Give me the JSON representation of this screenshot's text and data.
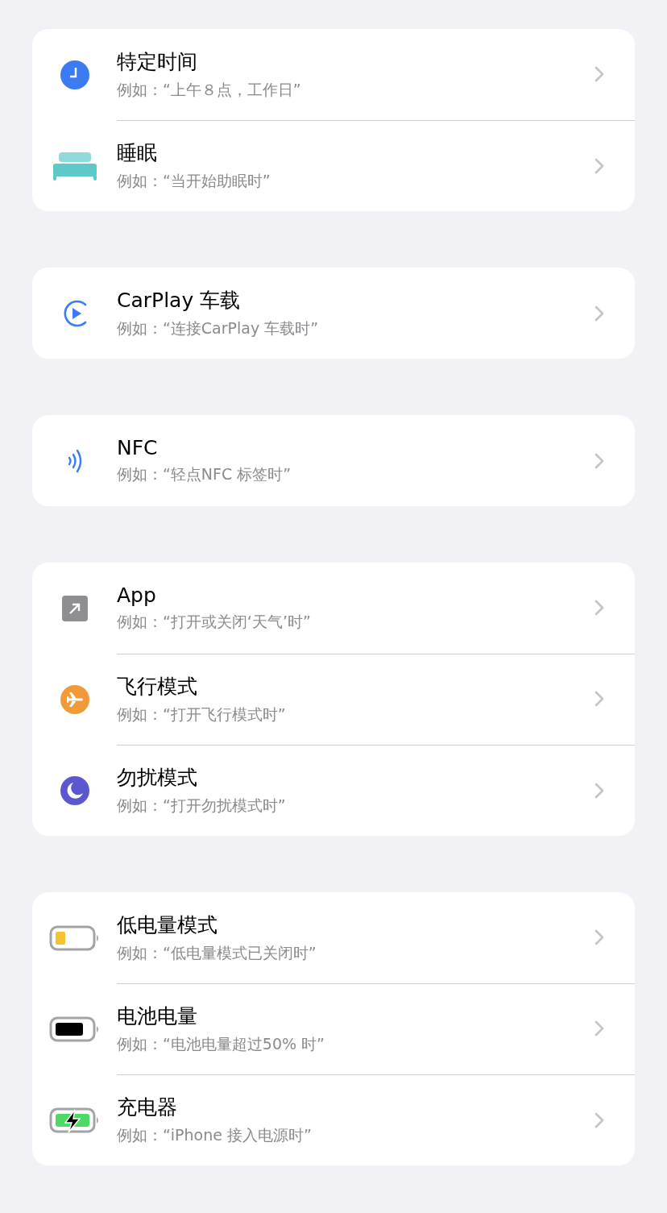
{
  "groups": [
    {
      "items": [
        {
          "kind": "time",
          "title": "特定时间",
          "subtitle": "例如：“上午８点，工作日”"
        },
        {
          "kind": "sleep",
          "title": "睡眠",
          "subtitle": "例如：“当开始助眠时”"
        }
      ]
    },
    {
      "items": [
        {
          "kind": "carplay",
          "title": "CarPlay 车载",
          "subtitle": "例如：“连接CarPlay 车载时”"
        }
      ]
    },
    {
      "items": [
        {
          "kind": "nfc",
          "title": "NFC",
          "subtitle": "例如：“轻点NFC 标签时”"
        }
      ]
    },
    {
      "items": [
        {
          "kind": "app",
          "title": "App",
          "subtitle": "例如：“打开或关闭‘天气’时”"
        },
        {
          "kind": "airplane",
          "title": "飞行模式",
          "subtitle": "例如：“打开飞行模式时”"
        },
        {
          "kind": "focus",
          "title": "勿扰模式",
          "subtitle": "例如：“打开勿扰模式时”"
        }
      ]
    },
    {
      "items": [
        {
          "kind": "low-power",
          "title": "低电量模式",
          "subtitle": "例如：“低电量模式已关闭时”"
        },
        {
          "kind": "battery-level",
          "title": "电池电量",
          "subtitle": "例如：“电池电量超过50% 时”"
        },
        {
          "kind": "charger",
          "title": "充电器",
          "subtitle": "例如：“iPhone 接入电源时”"
        }
      ]
    }
  ]
}
